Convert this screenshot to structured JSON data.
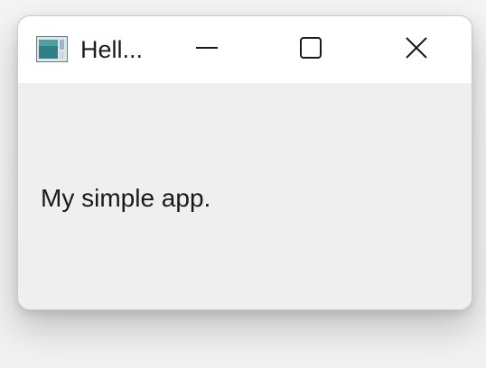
{
  "window": {
    "title": "Hell...",
    "icon": "app-window-icon",
    "controls": {
      "minimize": "minimize-icon",
      "maximize": "maximize-icon",
      "close": "close-icon"
    }
  },
  "content": {
    "label_text": "My simple app."
  }
}
